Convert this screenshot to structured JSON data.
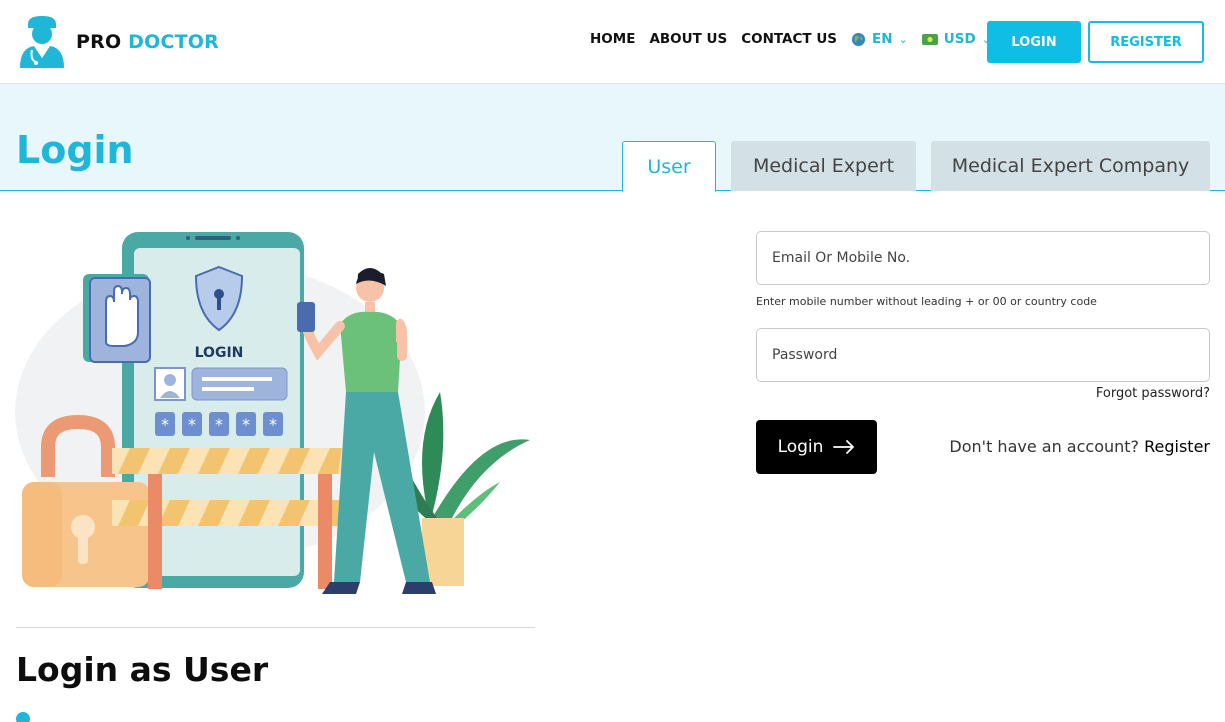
{
  "brand": {
    "name_part1": "PRO",
    "name_part2": "DOCTOR",
    "accent_color": "#1fb6d8"
  },
  "nav": {
    "items": [
      "HOME",
      "ABOUT US",
      "CONTACT US"
    ],
    "language": {
      "value": "EN",
      "icon": "globe-icon"
    },
    "currency": {
      "value": "USD",
      "icon": "banknote-icon"
    },
    "login_label": "LOGIN",
    "register_label": "REGISTER"
  },
  "banner": {
    "title": "Login",
    "tabs": [
      {
        "label": "User",
        "active": true
      },
      {
        "label": "Medical Expert",
        "active": false
      },
      {
        "label": "Medical Expert Company",
        "active": false
      }
    ]
  },
  "illustration": {
    "screen_text": "LOGIN"
  },
  "form": {
    "email_placeholder": "Email Or Mobile No.",
    "email_value": "",
    "hint": "Enter mobile number without leading + or 00 or country code",
    "password_placeholder": "Password",
    "password_value": "",
    "forgot_label": "Forgot password?",
    "login_label": "Login",
    "no_account_text": "Don't have an account? ",
    "register_link": "Register"
  },
  "section": {
    "title": "Login as User"
  }
}
